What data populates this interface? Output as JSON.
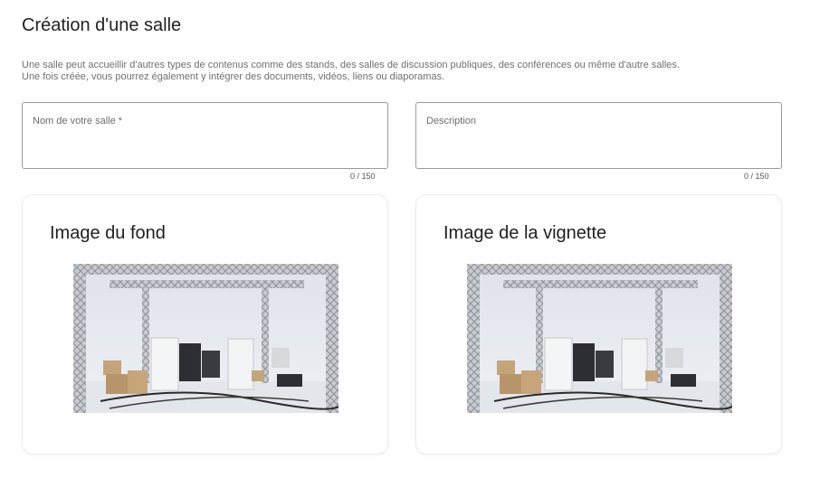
{
  "page": {
    "title": "Création d'une salle",
    "intro_line1": "Une salle peut accueillir d'autres types de contenus comme des stands, des salles de discussion publiques, des conférences ou même d'autre salles.",
    "intro_line2": "Une fois créée, vous pourrez également y intégrer des documents, vidéos, liens ou diaporamas."
  },
  "form": {
    "name_field": {
      "label": "Nom de votre salle *",
      "value": "",
      "counter": "0 / 150"
    },
    "description_field": {
      "label": "Description",
      "value": "",
      "counter": "0 / 150"
    }
  },
  "cards": {
    "background": {
      "title": "Image du fond",
      "image_icon": "stage-truss-image"
    },
    "thumbnail": {
      "title": "Image de la vignette",
      "image_icon": "stage-truss-image"
    }
  },
  "colors": {
    "border": "#9a9a9a",
    "text_muted": "#707070",
    "card_border": "#ececec"
  }
}
